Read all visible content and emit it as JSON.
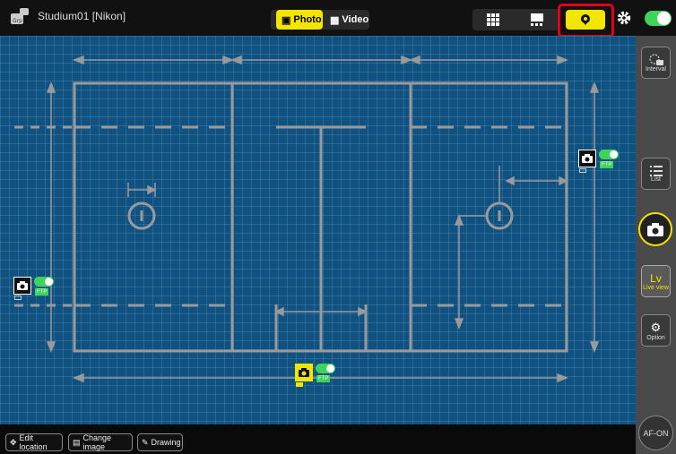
{
  "header": {
    "title": "Studium01 [Nikon]",
    "photo_label": "Photo",
    "video_label": "Video"
  },
  "bottom": {
    "edit_location": "Edit location",
    "change_image": "Change image",
    "drawing": "Drawing"
  },
  "sidebar": {
    "interval": "Interval",
    "list": "List",
    "lv_big": "Lv",
    "lv_small": "Live view",
    "option": "Option",
    "af_on": "AF-ON"
  },
  "cameras": [
    {
      "ftp": "FTP",
      "state": "on"
    },
    {
      "ftp": "FTP",
      "state": "on"
    },
    {
      "ftp": "FTP",
      "state": "on",
      "selected": true
    }
  ],
  "colors": {
    "accent": "#f2e600",
    "toggle_on": "#3ed35a",
    "canvas_bg": "#0f5282",
    "highlight": "#e0001b"
  }
}
